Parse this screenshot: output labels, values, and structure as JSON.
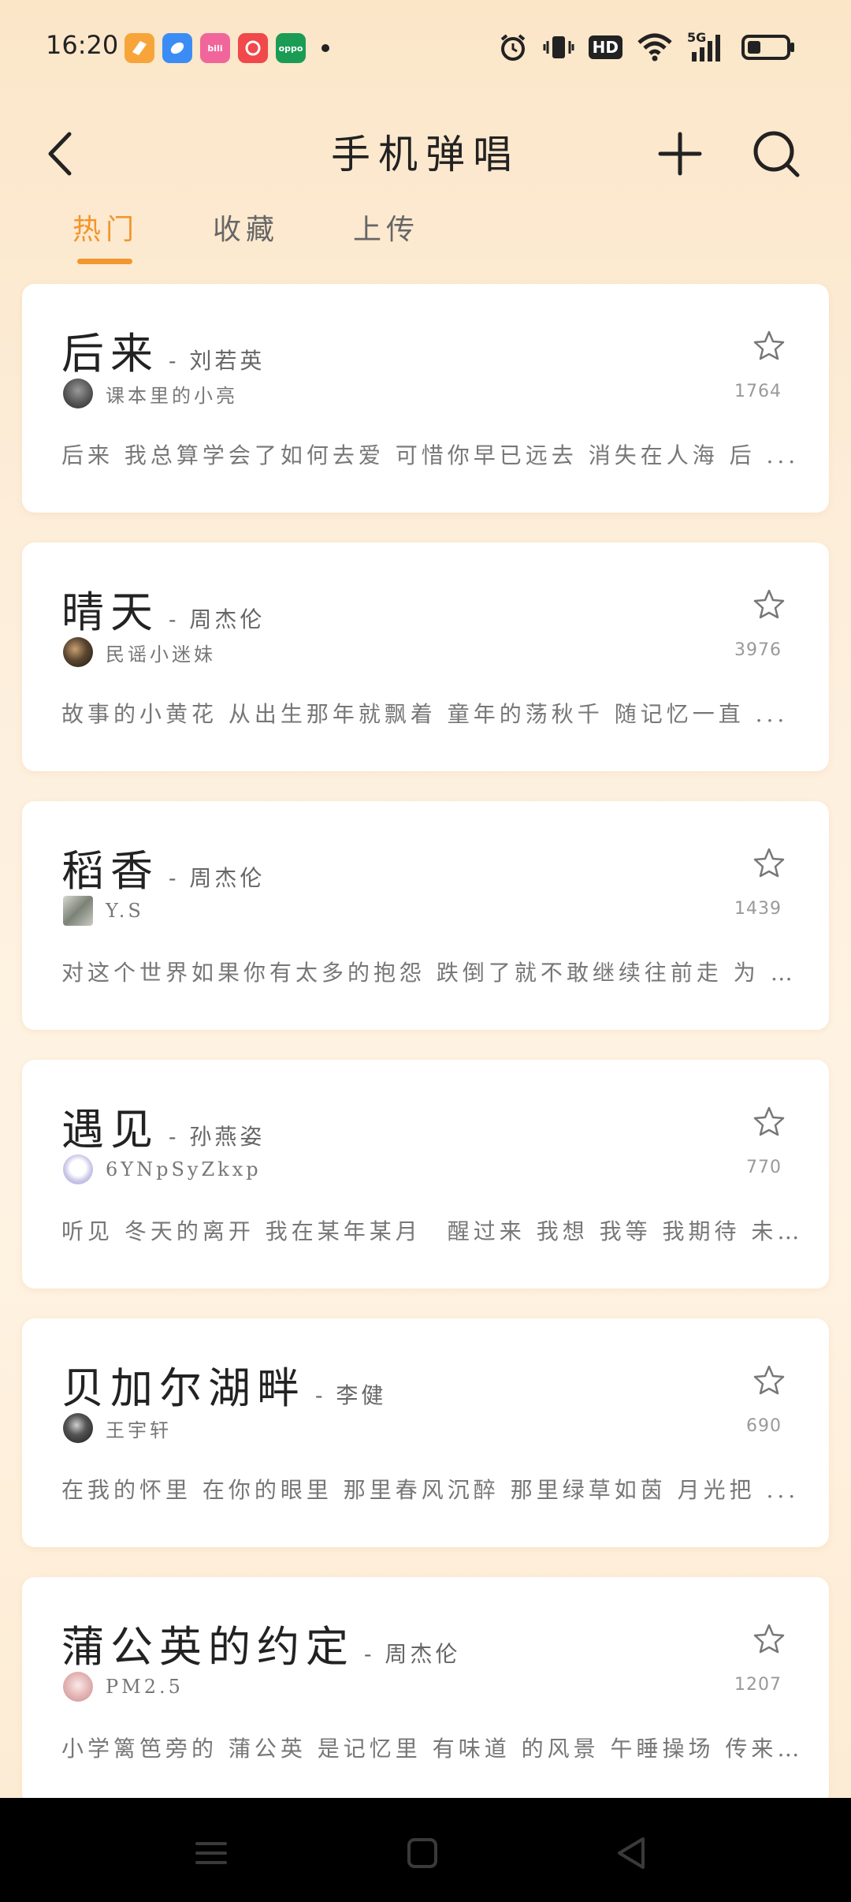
{
  "status_bar": {
    "time": "16:20",
    "app_icons": [
      {
        "name": "notification-app-1-icon",
        "color": "#f7a53a",
        "label": ""
      },
      {
        "name": "notification-app-2-icon",
        "color": "#3b8df5",
        "label": ""
      },
      {
        "name": "bilibili-icon",
        "color": "#f0669b",
        "label": "bili"
      },
      {
        "name": "notification-app-4-icon",
        "color": "#f0484b",
        "label": ""
      },
      {
        "name": "oppo-icon",
        "color": "#1a9c55",
        "label": "oppo"
      }
    ],
    "hd_label": "HD",
    "network_label": "5G"
  },
  "header": {
    "title": "手机弹唱"
  },
  "tabs": [
    {
      "label": "热门",
      "active": true
    },
    {
      "label": "收藏",
      "active": false
    },
    {
      "label": "上传",
      "active": false
    }
  ],
  "songs": [
    {
      "title": "后来",
      "artist": "- 刘若英",
      "uploader": "课本里的小亮",
      "plays": "1764",
      "lyrics": "后来 我总算学会了如何去爱 可惜你早已远去 消失在人海 后 ...",
      "avatar_color": "#555555"
    },
    {
      "title": "晴天",
      "artist": "- 周杰伦",
      "uploader": "民谣小迷妹",
      "plays": "3976",
      "lyrics": "故事的小黄花 从出生那年就飘着 童年的荡秋千 随记忆一直 ...",
      "avatar_color": "#3a3025"
    },
    {
      "title": "稻香",
      "artist": "- 周杰伦",
      "uploader": "Y.S",
      "plays": "1439",
      "lyrics": "对这个世界如果你有太多的抱怨 跌倒了就不敢继续往前走 为 ...",
      "avatar_color": "#8a8f86"
    },
    {
      "title": "遇见",
      "artist": "- 孙燕姿",
      "uploader": "6YNpSyZkxp",
      "plays": "770",
      "lyrics": "听见 冬天的离开 我在某年某月　醒过来 我想 我等 我期待 未 ...",
      "avatar_color": "#c9c6e8"
    },
    {
      "title": "贝加尔湖畔",
      "artist": "- 李健",
      "uploader": "王宇轩",
      "plays": "690",
      "lyrics": "在我的怀里 在你的眼里 那里春风沉醉 那里绿草如茵 月光把 ...",
      "avatar_color": "#2a2a2a"
    },
    {
      "title": "蒲公英的约定",
      "artist": "- 周杰伦",
      "uploader": "PM2.5",
      "plays": "1207",
      "lyrics": "小学篱笆旁的 蒲公英 是记忆里 有味道 的风景 午睡操场 传来 ...",
      "avatar_color": "#d8a8a8"
    }
  ],
  "colors": {
    "accent": "#f2962d",
    "card_bg": "#ffffff",
    "nav_bg": "#000000"
  }
}
